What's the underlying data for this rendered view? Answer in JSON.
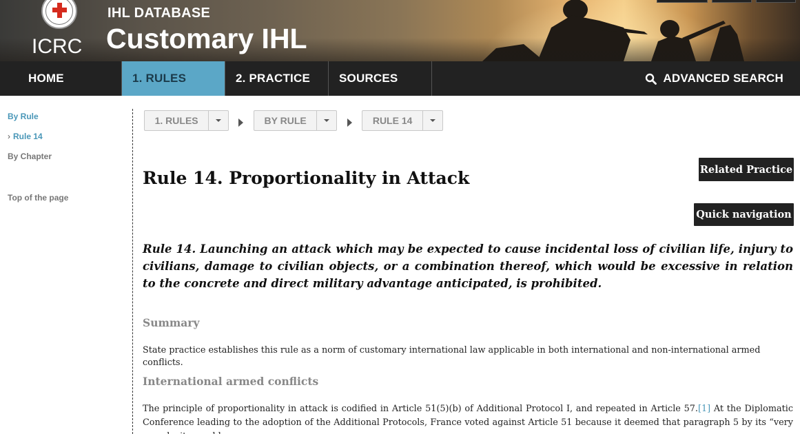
{
  "header": {
    "logo_text": "ICRC",
    "database_label": "IHL DATABASE",
    "site_title": "Customary IHL"
  },
  "nav": {
    "home": "HOME",
    "rules": "1. RULES",
    "practice": "2. PRACTICE",
    "sources": "SOURCES",
    "advanced_search": "ADVANCED SEARCH"
  },
  "sidebar": {
    "by_rule": "By Rule",
    "rule_14": "Rule 14",
    "by_chapter": "By Chapter",
    "top_of_page": "Top of the page"
  },
  "breadcrumb": {
    "level1": "1. RULES",
    "level2": "BY RULE",
    "level3": "RULE 14"
  },
  "content": {
    "rule_title": "Rule 14. Proportionality in Attack",
    "related_practice": "Related Practice",
    "quick_navigation": "Quick navigation",
    "rule_statement": "Rule 14. Launching an attack which may be expected to cause incidental loss of civilian life, injury to civilians, damage to civilian objects, or a combination thereof, which would be excessive in relation to the concrete and direct military advantage anticipated, is prohibited.",
    "summary_heading": "Summary",
    "summary_text": "State practice establishes this rule as a norm of customary international law applicable in both international and non-international armed conflicts.",
    "iac_heading": "International armed conflicts",
    "iac_text_before_fn": "The principle of proportionality in attack is codified in Article 51(5)(b) of Additional Protocol I, and repeated in Article 57.",
    "iac_footnote": "[1]",
    "iac_text_after_fn": " At the Diplomatic Conference leading to the adoption of the Additional Protocols, France voted against Article 51 because it deemed that paragraph 5 by its “very complexity would"
  },
  "colors": {
    "accent": "#5ba7c7",
    "link": "#4a97b8",
    "nav_bg": "#222222",
    "button_bg": "#222222",
    "emblem_red": "#d52b1e"
  },
  "icons": {
    "search": "search-icon",
    "emblem": "red-cross-emblem-icon",
    "breadcrumb_separator": "triangle-right-icon",
    "dropdown": "caret-down-icon",
    "sidebar_bullet": "chevron-right-icon"
  }
}
